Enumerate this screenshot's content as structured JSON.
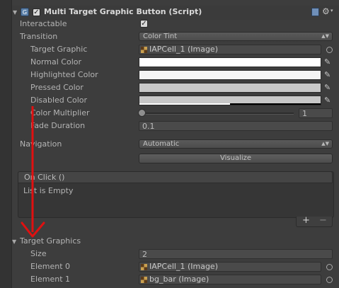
{
  "component": {
    "title": "Multi Target Graphic Button (Script)",
    "enabled_checked": true
  },
  "fields": {
    "interactable": {
      "label": "Interactable",
      "checked": true
    },
    "transition": {
      "label": "Transition",
      "value": "Color Tint"
    },
    "target_graphic": {
      "label": "Target Graphic",
      "value": "IAPCell_1 (Image)"
    },
    "normal_color": {
      "label": "Normal Color",
      "color": "#ffffff"
    },
    "highlighted_color": {
      "label": "Highlighted Color",
      "color": "#f5f5f5"
    },
    "pressed_color": {
      "label": "Pressed Color",
      "color": "#c8c8c8"
    },
    "disabled_color": {
      "label": "Disabled Color",
      "color": "#c8c8c8",
      "alpha_fraction": 0.5
    },
    "color_multiplier": {
      "label": "Color Multiplier",
      "value": "1"
    },
    "fade_duration": {
      "label": "Fade Duration",
      "value": "0.1"
    },
    "navigation": {
      "label": "Navigation",
      "value": "Automatic"
    },
    "visualize_label": "Visualize"
  },
  "on_click": {
    "header": "On Click ()",
    "empty_text": "List is Empty",
    "add_label": "+",
    "remove_label": "−"
  },
  "target_graphics": {
    "label": "Target Graphics",
    "size_label": "Size",
    "size_value": "2",
    "elements": [
      {
        "label": "Element 0",
        "value": "IAPCell_1 (Image)"
      },
      {
        "label": "Element 1",
        "value": "bg_bar (Image)"
      }
    ]
  },
  "annotation": {
    "arrow_color": "#e01010"
  }
}
